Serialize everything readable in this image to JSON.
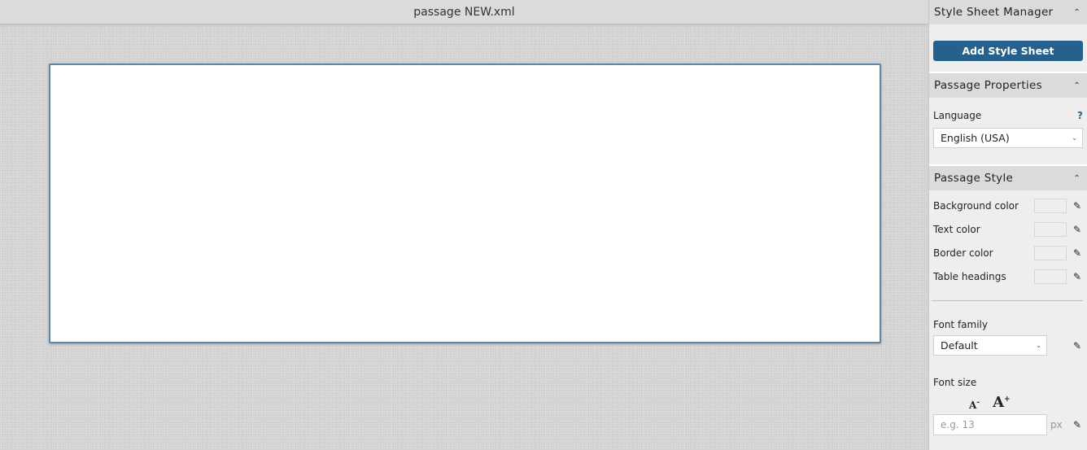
{
  "document": {
    "title": "passage NEW.xml"
  },
  "panel": {
    "style_sheet_manager": {
      "heading": "Style Sheet Manager",
      "add_button": "Add Style Sheet"
    },
    "passage_properties": {
      "heading": "Passage Properties",
      "language_label": "Language",
      "help": "?",
      "language_value": "English (USA)"
    },
    "passage_style": {
      "heading": "Passage Style",
      "colors": [
        {
          "label": "Background color"
        },
        {
          "label": "Text color"
        },
        {
          "label": "Border color"
        },
        {
          "label": "Table headings"
        }
      ],
      "font_family_label": "Font family",
      "font_family_value": "Default",
      "font_size_label": "Font size",
      "decrease": "A",
      "increase": "A",
      "font_size_placeholder": "e.g. 13",
      "unit": "px"
    }
  },
  "icons": {
    "chevron": "⌃",
    "caret": "⌄",
    "eraser": "✐"
  }
}
